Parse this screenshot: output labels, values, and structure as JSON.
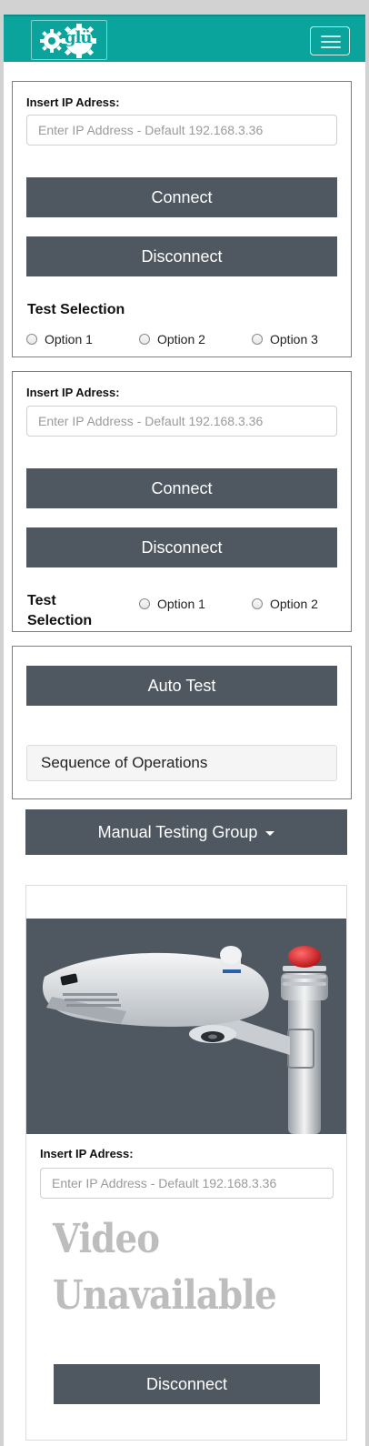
{
  "header": {
    "logo_text": "glü",
    "menu_toggle": "menu-icon"
  },
  "panel1": {
    "ip_label": "Insert IP Adress:",
    "ip_placeholder": "Enter IP Address - Default 192.168.3.36",
    "connect_label": "Connect",
    "disconnect_label": "Disconnect",
    "test_selection_title": "Test Selection",
    "options": [
      "Option 1",
      "Option 2",
      "Option 3"
    ]
  },
  "panel2": {
    "ip_label": "Insert IP Adress:",
    "ip_placeholder": "Enter IP Address - Default 192.168.3.36",
    "connect_label": "Connect",
    "disconnect_label": "Disconnect",
    "test_selection_title_line1": "Test",
    "test_selection_title_line2": "Selection",
    "options": [
      "Option 1",
      "Option 2"
    ]
  },
  "panel3": {
    "auto_test_label": "Auto Test",
    "sequence_label": "Sequence of Operations"
  },
  "manual_group": {
    "label": "Manual Testing Group",
    "caret": "caret-down-icon"
  },
  "device_card": {
    "image": "street-light-camera-image",
    "ip_label": "Insert IP Adress:",
    "ip_placeholder": "Enter IP Address - Default 192.168.3.36",
    "video_line1": "Video",
    "video_line2": "Unavailable",
    "disconnect_label": "Disconnect"
  },
  "colors": {
    "brand_teal": "#0aa49d",
    "button_dark": "#4f5861",
    "alarm_red": "#e0191e"
  }
}
